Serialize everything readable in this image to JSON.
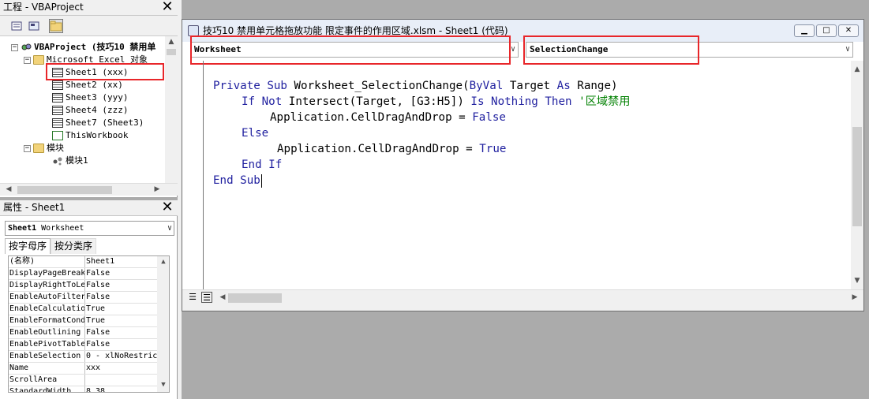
{
  "project_pane": {
    "title": "工程 - VBAProject",
    "close": "✕",
    "tree": [
      {
        "label": "VBAProject (技巧10 禁用单",
        "icon": "vbaproject-icon",
        "expander": "−"
      },
      {
        "label": "Microsoft Excel 对象",
        "icon": "folder-icon",
        "expander": "−"
      },
      {
        "label": "Sheet1 (xxx)",
        "icon": "worksheet-icon",
        "expander": ""
      },
      {
        "label": "Sheet2 (xx)",
        "icon": "worksheet-icon",
        "expander": ""
      },
      {
        "label": "Sheet3 (yyy)",
        "icon": "worksheet-icon",
        "expander": ""
      },
      {
        "label": "Sheet4 (zzz)",
        "icon": "worksheet-icon",
        "expander": ""
      },
      {
        "label": "Sheet7 (Sheet3)",
        "icon": "worksheet-icon",
        "expander": ""
      },
      {
        "label": "ThisWorkbook",
        "icon": "workbook-icon",
        "expander": ""
      },
      {
        "label": "模块",
        "icon": "folder-icon",
        "expander": "−"
      },
      {
        "label": "模块1",
        "icon": "module-icon",
        "expander": ""
      }
    ]
  },
  "props_pane": {
    "title": "属性 - Sheet1",
    "close": "✕",
    "object_bold": "Sheet1",
    "object_type": "Worksheet",
    "tabs": [
      "按字母序",
      "按分类序"
    ],
    "rows": [
      {
        "k": "(名称)",
        "v": "Sheet1"
      },
      {
        "k": "DisplayPageBreak",
        "v": "False"
      },
      {
        "k": "DisplayRightToLe",
        "v": "False"
      },
      {
        "k": "EnableAutoFilter",
        "v": "False"
      },
      {
        "k": "EnableCalculatio",
        "v": "True"
      },
      {
        "k": "EnableFormatCond",
        "v": "True"
      },
      {
        "k": "EnableOutlining",
        "v": "False"
      },
      {
        "k": "EnablePivotTable",
        "v": "False"
      },
      {
        "k": "EnableSelection",
        "v": "0 - xlNoRestric"
      },
      {
        "k": "Name",
        "v": "xxx"
      },
      {
        "k": "ScrollArea",
        "v": ""
      },
      {
        "k": "StandardWidth",
        "v": "8.38"
      }
    ]
  },
  "code_window": {
    "title": "技巧10 禁用单元格拖放功能 限定事件的作用区域.xlsm - Sheet1 (代码)",
    "object_combo": "Worksheet",
    "proc_combo": "SelectionChange",
    "lines": {
      "l1_kw1": "Private Sub",
      "l1_rest": " Worksheet_SelectionChange(",
      "l1_kw2": "ByVal",
      "l1_rest2": " Target ",
      "l1_kw3": "As",
      "l1_rest3": " Range)",
      "l2_kw1": "If Not",
      "l2_rest": " Intersect(Target, [G3:H5]) ",
      "l2_kw2": "Is Nothing Then",
      "l2_cm": " '区域禁用",
      "l3_rest": "Application.CellDragAndDrop = ",
      "l3_kw": "False",
      "l4_kw": "Else",
      "l5_rest": "Application.CellDragAndDrop = ",
      "l5_kw": "True",
      "l6_kw": "End If",
      "l7_kw": "End Sub"
    }
  },
  "colors": {
    "keyword": "#1f1f9f",
    "comment": "#008000",
    "highlight": "#e8262a"
  }
}
